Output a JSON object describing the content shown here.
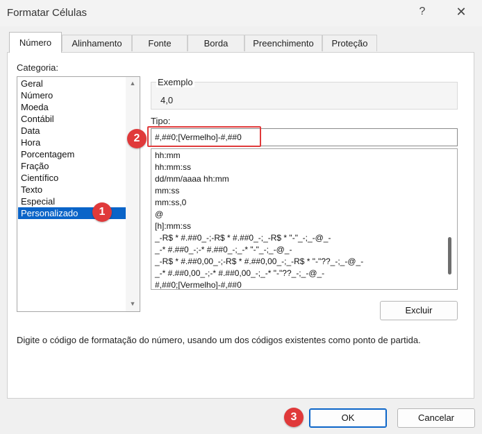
{
  "window": {
    "title": "Formatar Células",
    "help_label": "?",
    "close_label": "✕"
  },
  "tabs": [
    {
      "label": "Número",
      "active": true
    },
    {
      "label": "Alinhamento"
    },
    {
      "label": "Fonte"
    },
    {
      "label": "Borda"
    },
    {
      "label": "Preenchimento"
    },
    {
      "label": "Proteção"
    }
  ],
  "categoria": {
    "label": "Categoria:",
    "items": [
      "Geral",
      "Número",
      "Moeda",
      "Contábil",
      "Data",
      "Hora",
      "Porcentagem",
      "Fração",
      "Científico",
      "Texto",
      "Especial",
      "Personalizado"
    ],
    "selected": "Personalizado"
  },
  "exemplo": {
    "label": "Exemplo",
    "value": "4,0"
  },
  "tipo": {
    "label": "Tipo:",
    "value": "#,##0;[Vermelho]-#,##0",
    "list": [
      "hh:mm",
      "hh:mm:ss",
      "dd/mm/aaaa hh:mm",
      "mm:ss",
      "mm:ss,0",
      "@",
      "[h]:mm:ss",
      "_-R$ * #.##0_-;-R$ * #.##0_-;_-R$ * \"-\"_-;_-@_-",
      "_-* #.##0_-;-* #.##0_-;_-* \"-\"_-;_-@_-",
      "_-R$ * #.##0,00_-;-R$ * #.##0,00_-;_-R$ * \"-\"??_-;_-@_-",
      "_-* #.##0,00_-;-* #.##0,00_-;_-* \"-\"??_-;_-@_-",
      "#,##0;[Vermelho]-#,##0"
    ]
  },
  "buttons": {
    "excluir": "Excluir",
    "ok": "OK",
    "cancelar": "Cancelar"
  },
  "hint": "Digite o código de formatação do número, usando um dos códigos existentes como ponto de partida.",
  "badges": {
    "one": "1",
    "two": "2",
    "three": "3"
  },
  "icons": {
    "scroll_up": "scroll-up-arrow-icon",
    "scroll_down": "scroll-down-arrow-icon"
  },
  "colors": {
    "accent": "#0a64c8",
    "badge": "#e0393a"
  }
}
